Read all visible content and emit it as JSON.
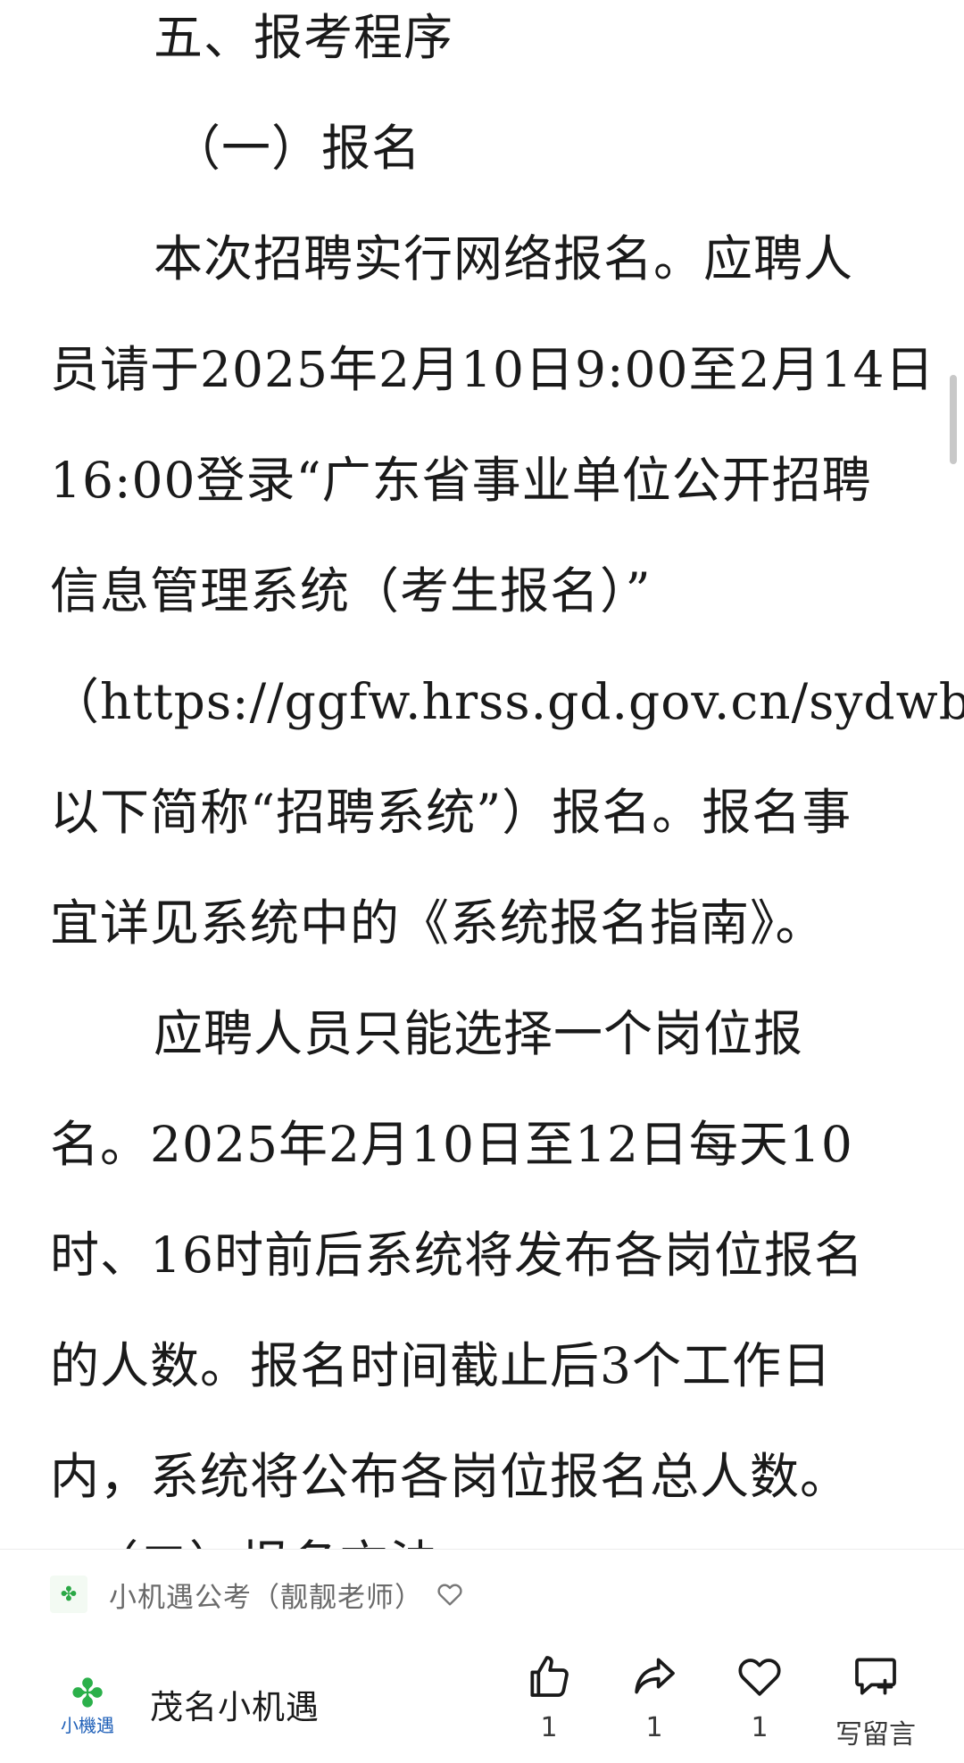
{
  "article": {
    "lines": [
      "五、报考程序",
      "（一）报名",
      "本次招聘实行网络报名。应聘人",
      "员请于2025年2月10日9:00至2月14日",
      "16:00登录“广东省事业单位公开招聘",
      "信息管理系统（考生报名）”",
      "（https://ggfw.hrss.gd.gov.cn/sydwbk，",
      "以下简称“招聘系统”）报名。报名事",
      "宜详见系统中的《系统报名指南》。",
      "应聘人员只能选择一个岗位报",
      "名。2025年2月10日至12日每天10",
      "时、16时前后系统将发布各岗位报名",
      "的人数。报名时间截止后3个工作日",
      "内，系统将公布各岗位报名总人数。",
      "（二）报名方法"
    ]
  },
  "footer": {
    "source_name": "小机遇公考（靓靓老师）",
    "account_name": "茂名小机遇",
    "logo_text": "小機遇",
    "actions": {
      "like_count": "1",
      "share_count": "1",
      "heart_count": "1",
      "comment_label": "写留言"
    }
  },
  "icons": {
    "source_heart": "heart-outline-icon",
    "like": "thumbs-up-icon",
    "share": "share-arrow-icon",
    "heart": "heart-icon",
    "comment": "comment-add-icon"
  },
  "colors": {
    "text": "#1a1a1a",
    "muted": "#6a6a6a",
    "clover": "#2bb04a"
  }
}
